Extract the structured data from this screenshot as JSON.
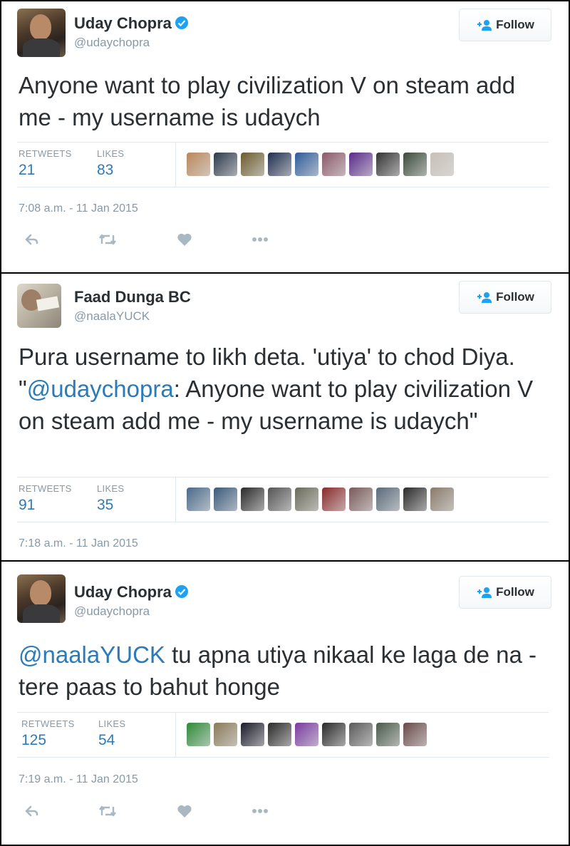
{
  "colors": {
    "text": "#292f33",
    "muted": "#8899a6",
    "link": "#2b7bb9",
    "verified": "#1da1f2"
  },
  "tweets": [
    {
      "author": {
        "name": "Uday Chopra",
        "handle": "@udaychopra",
        "verified": true,
        "avatar": "uday-avatar"
      },
      "follow_label": "Follow",
      "text_parts": [
        {
          "text": "Anyone want to play civilization V on steam add me - my username is udaych",
          "mention": false
        }
      ],
      "stats": {
        "retweets_label": "RETWEETS",
        "retweets": "21",
        "likes_label": "LIKES",
        "likes": "83"
      },
      "likers": [
        "#b9875c",
        "#2c3a4a",
        "#6b5b2e",
        "#1f2f4f",
        "#2e5c9a",
        "#8c5a6a",
        "#5a2a8a",
        "#333333",
        "#3a4a3a",
        "#c8c0b8"
      ],
      "timestamp": "7:08 a.m. - 11 Jan 2015",
      "actions": [
        "reply-icon",
        "retweet-icon",
        "like-icon",
        "more-icon"
      ]
    },
    {
      "author": {
        "name": "Faad Dunga BC",
        "handle": "@naalaYUCK",
        "verified": false,
        "avatar": "faad-avatar"
      },
      "follow_label": "Follow",
      "text_parts": [
        {
          "text": "Pura username to likh deta. 'utiya' to chod Diya. \"",
          "mention": false
        },
        {
          "text": "@udaychopra",
          "mention": true
        },
        {
          "text": ": Anyone want to play civilization V on steam add me - my username is udaych\"",
          "mention": false
        }
      ],
      "stats": {
        "retweets_label": "RETWEETS",
        "retweets": "91",
        "likes_label": "LIKES",
        "likes": "35"
      },
      "likers": [
        "#4a6a8a",
        "#3a5a7a",
        "#2a2a2a",
        "#555555",
        "#6a6a5a",
        "#8a2a2a",
        "#7a5a5a",
        "#5a6a7a",
        "#2a2a2a",
        "#8a7a6a"
      ],
      "timestamp": "7:18 a.m. - 11 Jan 2015",
      "actions": []
    },
    {
      "author": {
        "name": "Uday Chopra",
        "handle": "@udaychopra",
        "verified": true,
        "avatar": "uday-avatar"
      },
      "follow_label": "Follow",
      "text_parts": [
        {
          "text": "@naalaYUCK",
          "mention": true
        },
        {
          "text": " tu apna utiya nikaal ke laga de na - tere paas to bahut honge",
          "mention": false
        }
      ],
      "stats": {
        "retweets_label": "RETWEETS",
        "retweets": "125",
        "likes_label": "LIKES",
        "likes": "54"
      },
      "likers": [
        "#2e8a3a",
        "#8a7a5a",
        "#1a1a2a",
        "#2a2a2a",
        "#7a3aa0",
        "#2a2a2a",
        "#5a5a5a",
        "#4a5a4a",
        "#6a4a4a"
      ],
      "timestamp": "7:19 a.m. - 11 Jan 2015",
      "actions": [
        "reply-icon",
        "retweet-icon",
        "like-icon",
        "more-icon"
      ]
    }
  ]
}
